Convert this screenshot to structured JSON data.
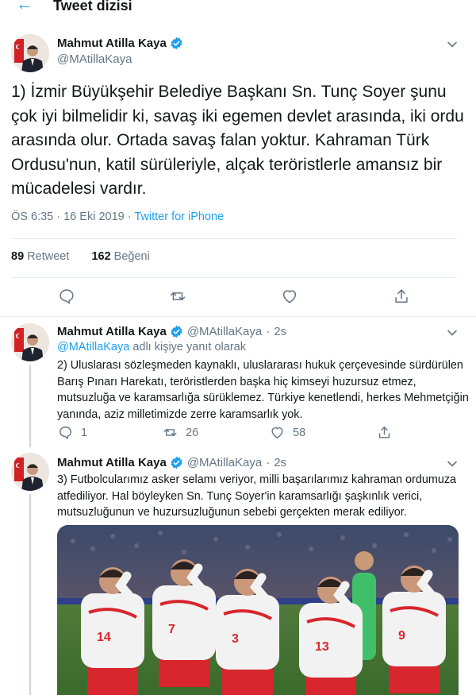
{
  "header": {
    "back_icon": "arrow-left-icon",
    "title": "Tweet dizisi"
  },
  "colors": {
    "accent": "#1da1f2",
    "secondary_text": "#657786",
    "divider": "#e6ecf0"
  },
  "main_tweet": {
    "display_name": "Mahmut Atilla Kaya",
    "handle": "@MAtillaKaya",
    "text": "1) İzmir Büyükşehir Belediye Başkanı Sn. Tunç Soyer şunu çok iyi bilmelidir ki, savaş iki egemen devlet arasında, iki ordu arasında olur. Ortada savaş falan yoktur. Kahraman Türk Ordusu'nun, katil sürüleriyle, alçak teröristlerle amansız bir mücadelesi vardır.",
    "time": "ÖS 6:35",
    "date": "16 Eki 2019",
    "separator": "·",
    "source": "Twitter for iPhone",
    "retweet_count": "89",
    "retweet_label": "Retweet",
    "like_count": "162",
    "like_label": "Beğeni"
  },
  "replies": [
    {
      "display_name": "Mahmut Atilla Kaya",
      "handle": "@MAtillaKaya",
      "separator": "·",
      "time_ago": "2s",
      "reply_mention": "@MAtillaKaya",
      "reply_suffix": "adlı kişiye yanıt olarak",
      "text": "2) Uluslarası sözleşmeden kaynaklı, uluslararası hukuk çerçevesinde sürdürülen Barış Pınarı Harekatı, teröristlerden başka hiç kimseyi huzursuz etmez, mutsuzluğa ve karamsarlığa sürüklemez. Türkiye kenetlendi, herkes Mehmetçiğin yanında, aziz milletimizde zerre karamsarlık yok.",
      "reply_count": "1",
      "retweet_count": "26",
      "like_count": "58"
    },
    {
      "display_name": "Mahmut Atilla Kaya",
      "handle": "@MAtillaKaya",
      "separator": "·",
      "time_ago": "2s",
      "text": "3) Futbolcularımız asker selamı veriyor, milli başarılarımız kahraman ordumuza atfediliyor. Hal böyleyken Sn. Tunç Soyer'in karamsarlığı şaşkınlık verici, mutsuzluğunun ve huzursuzluğunun sebebi gerçekten merak ediliyor.",
      "media": {
        "description_icon": "football-team-salute-photo",
        "jersey_numbers": [
          "14",
          "7",
          "3",
          "13",
          "9"
        ]
      }
    }
  ]
}
